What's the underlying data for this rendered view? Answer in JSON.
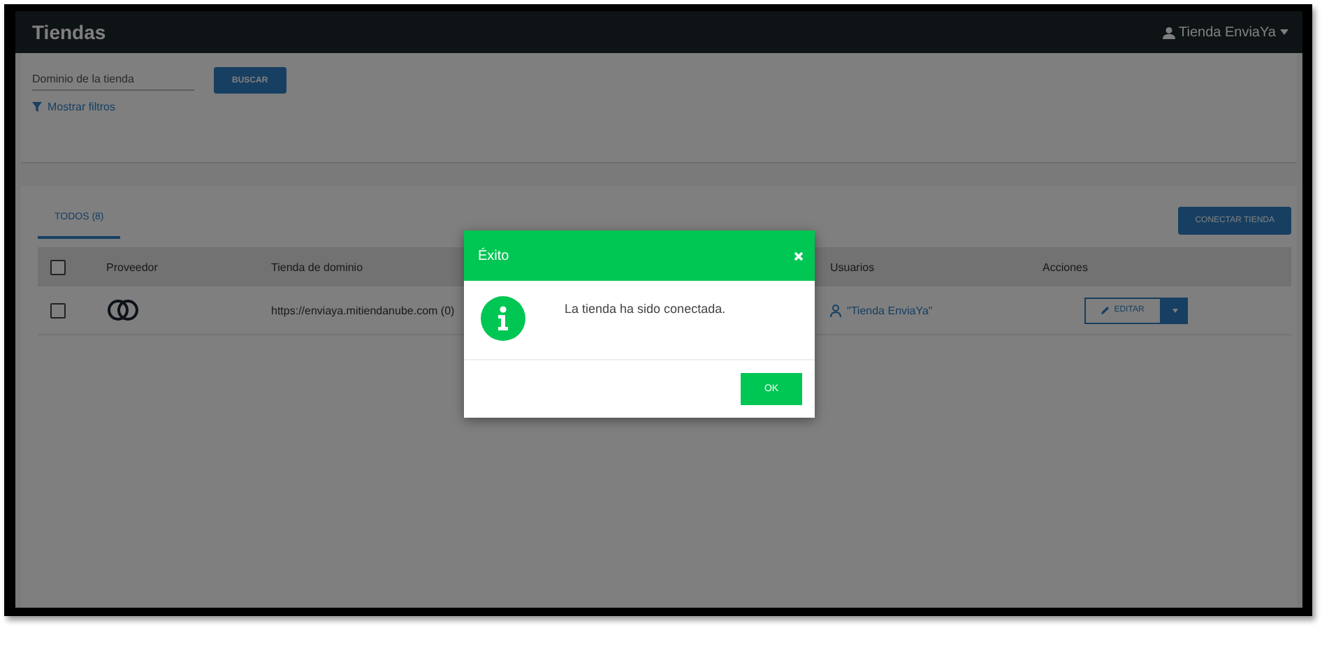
{
  "header": {
    "title": "Tiendas",
    "user": "Tienda EnviaYa"
  },
  "search": {
    "placeholder": "Dominio de la tienda",
    "button": "BUSCAR",
    "filters_link": "Mostrar filtros"
  },
  "tabs": [
    {
      "label": "TODOS (8)",
      "selected": true
    }
  ],
  "connect_button": "CONECTAR TIENDA",
  "table": {
    "select_all_checked": false,
    "columns": [
      "Proveedor",
      "Tienda de dominio",
      "Usuarios",
      "Acciones"
    ],
    "rows": [
      {
        "checked": false,
        "domain": "https://enviaya.mitiendanube.com (0)",
        "user": "\"Tienda EnviaYa\"",
        "action": "EDITAR"
      }
    ]
  },
  "modal": {
    "title": "Éxito",
    "message": "La tienda ha sido conectada.",
    "ok": "OK"
  }
}
